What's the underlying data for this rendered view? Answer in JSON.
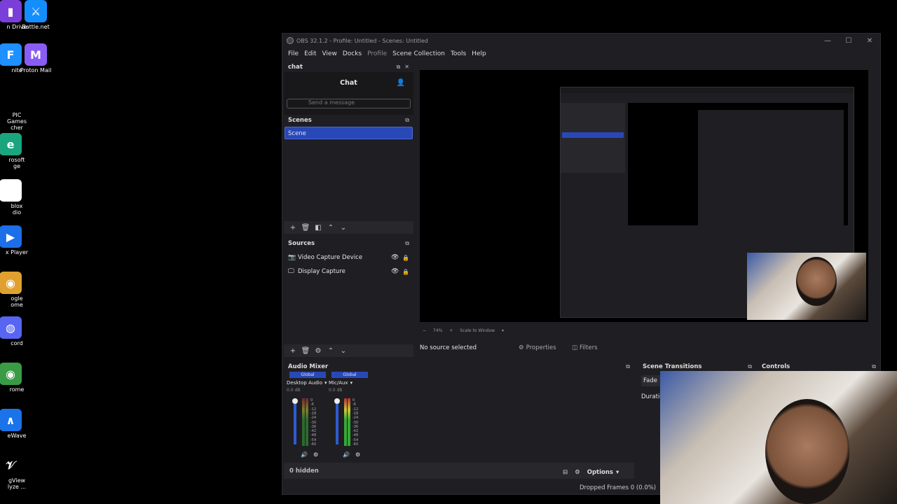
{
  "desktop": {
    "icons": [
      {
        "label": "n Drive",
        "glyph": "▮",
        "color": "#7a3fd8"
      },
      {
        "label": "Battle.net",
        "glyph": "⚔",
        "color": "#148eff"
      },
      {
        "label": "nite",
        "glyph": "F",
        "color": "#1e90ff"
      },
      {
        "label": "Proton Mail",
        "glyph": "M",
        "color": "#8a5cf6"
      },
      {
        "label": "PIC\nGames\ncher",
        "glyph": "",
        "color": "#000"
      },
      {
        "label": "rosoft\nge",
        "glyph": "e",
        "color": "#1aa57f"
      },
      {
        "label": "blox\ndio",
        "glyph": "■",
        "color": "#ffffff"
      },
      {
        "label": "x Player",
        "glyph": "▶",
        "color": "#1c6fe8"
      },
      {
        "label": "ogle\nome",
        "glyph": "◉",
        "color": "#e0a030"
      },
      {
        "label": "cord",
        "glyph": "◍",
        "color": "#5865f2"
      },
      {
        "label": "rome",
        "glyph": "◉",
        "color": "#3a9a45"
      },
      {
        "label": "eWave",
        "glyph": "∧",
        "color": "#1a73e8"
      },
      {
        "label": "gView\nlyze ...",
        "glyph": "𝒱",
        "color": "#000"
      }
    ]
  },
  "window": {
    "title": "OBS 32.1.2 - Profile: Untitled - Scenes: Untitled",
    "controls": [
      "—",
      "☐",
      "✕"
    ]
  },
  "menu": [
    "File",
    "Edit",
    "View",
    "Docks",
    "Profile",
    "Scene Collection",
    "Tools",
    "Help"
  ],
  "chat": {
    "dock_title": "chat",
    "header": "Chat",
    "placeholder": "Send a message"
  },
  "scenes": {
    "title": "Scenes",
    "items": [
      "Scene"
    ]
  },
  "sources": {
    "title": "Sources",
    "items": [
      {
        "label": "Video Capture Device",
        "icon": "camera-icon"
      },
      {
        "label": "Display Capture",
        "icon": "monitor-icon"
      }
    ]
  },
  "preview_toolbar": {
    "zoom": "74%",
    "scale": "Scale to Window"
  },
  "source_bar": {
    "status": "No source selected",
    "properties": "Properties",
    "filters": "Filters"
  },
  "audio_mixer": {
    "title": "Audio Mixer",
    "channels": [
      {
        "badge": "Global",
        "name": "Desktop Audio",
        "db": "0.0 dB",
        "level": 0.0
      },
      {
        "badge": "Global",
        "name": "Mic/Aux",
        "db": "0.0 dB",
        "level": 0.55
      }
    ],
    "ticks": [
      "0",
      "-6",
      "-12",
      "-18",
      "-24",
      "-30",
      "-36",
      "-42",
      "-48",
      "-54",
      "-60"
    ],
    "hidden": "0 hidden"
  },
  "transitions": {
    "title": "Scene Transitions",
    "type": "Fade",
    "duration_label": "Duratio"
  },
  "controls": {
    "title": "Controls"
  },
  "footer": {
    "options": "Options",
    "dropped": "Dropped Frames 0 (0.0%)"
  }
}
